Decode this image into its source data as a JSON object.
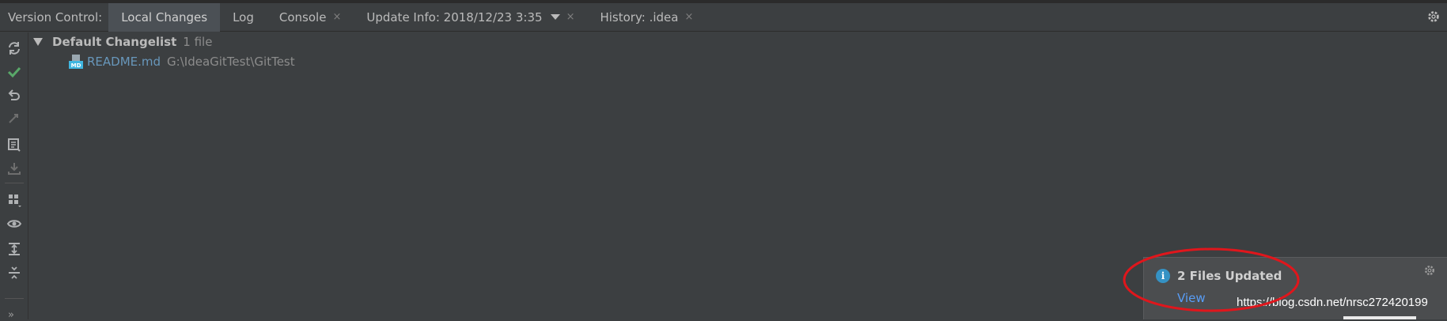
{
  "tabbar": {
    "title": "Version Control:",
    "tabs": [
      {
        "label": "Local Changes",
        "active": true
      },
      {
        "label": "Log"
      },
      {
        "label": "Console",
        "closable": true
      },
      {
        "label": "Update Info: 2018/12/23 3:35",
        "closable": true,
        "dropdown": true
      },
      {
        "label": "History: .idea",
        "closable": true
      }
    ],
    "close_glyph": "×",
    "gear_icon": "gear-icon"
  },
  "toolbar": {
    "icons": [
      "refresh-icon",
      "commit-check-icon",
      "rollback-icon",
      "show-diff-icon",
      "changelist-icon",
      "shelve-icon",
      "group-by-icon",
      "view-options-icon",
      "expand-all-icon",
      "collapse-all-icon"
    ],
    "more": "»"
  },
  "changelist": {
    "name": "Default Changelist",
    "count": "1 file",
    "files": [
      {
        "name": "README.md",
        "path": "G:\\IdeaGitTest\\GitTest",
        "icon": "markdown-file-icon"
      }
    ]
  },
  "notification": {
    "title": "2 Files Updated",
    "link": "View",
    "icon": "info-icon"
  },
  "watermark": "https://blog.csdn.net/nrsc272420199",
  "colors": {
    "background": "#3c3f41",
    "active_tab": "#4b5055",
    "file_link": "#6897bb",
    "accent_green": "#59a869",
    "info_blue": "#3592c4",
    "annotation_red": "#e0161c"
  }
}
